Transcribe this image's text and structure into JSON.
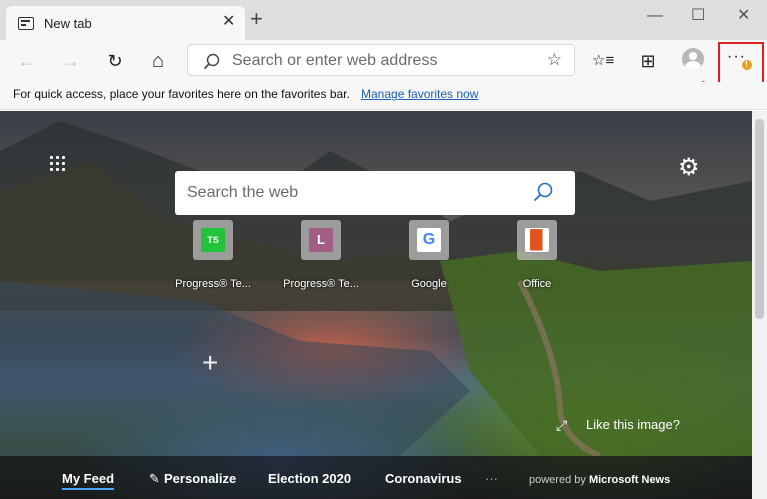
{
  "tab": {
    "title": "New tab",
    "close": "✕",
    "new_tab": "+"
  },
  "window": {
    "minimize": "—",
    "maximize": "☐",
    "close": "✕"
  },
  "toolbar": {
    "back": "←",
    "forward": "→",
    "refresh": "↻",
    "home": "⌂",
    "address_placeholder": "Search or enter web address",
    "favorite_star": "☆",
    "favorites": "☆≡",
    "collections": "⊞",
    "menu": "···",
    "menu_badge": "!"
  },
  "favorites_bar": {
    "text": "For quick access, place your favorites here on the favorites bar.",
    "link": "Manage favorites now"
  },
  "newtab": {
    "search_placeholder": "Search the web",
    "settings": "⚙",
    "tiles": [
      {
        "label": "Progress® Te...",
        "glyph": "TS",
        "color": "#22c33a"
      },
      {
        "label": "Progress® Te...",
        "glyph": "L",
        "color": "#a15d84"
      },
      {
        "label": "Google",
        "glyph": "G",
        "color": "#ffffff"
      },
      {
        "label": "Office",
        "glyph": "▉",
        "color": "#e2531b"
      }
    ],
    "add_tile": "+",
    "like_image": "Like this image?",
    "expand": "⤢"
  },
  "feed": {
    "tabs": [
      "My Feed",
      "Personalize",
      "Election 2020",
      "Coronavirus",
      "···"
    ],
    "personalize_icon": "✎",
    "powered_prefix": "powered by",
    "powered_brand": "Microsoft News"
  },
  "colors": {
    "accent": "#1a5fb4",
    "highlight": "#dd2222",
    "badge": "#e8a21a"
  }
}
